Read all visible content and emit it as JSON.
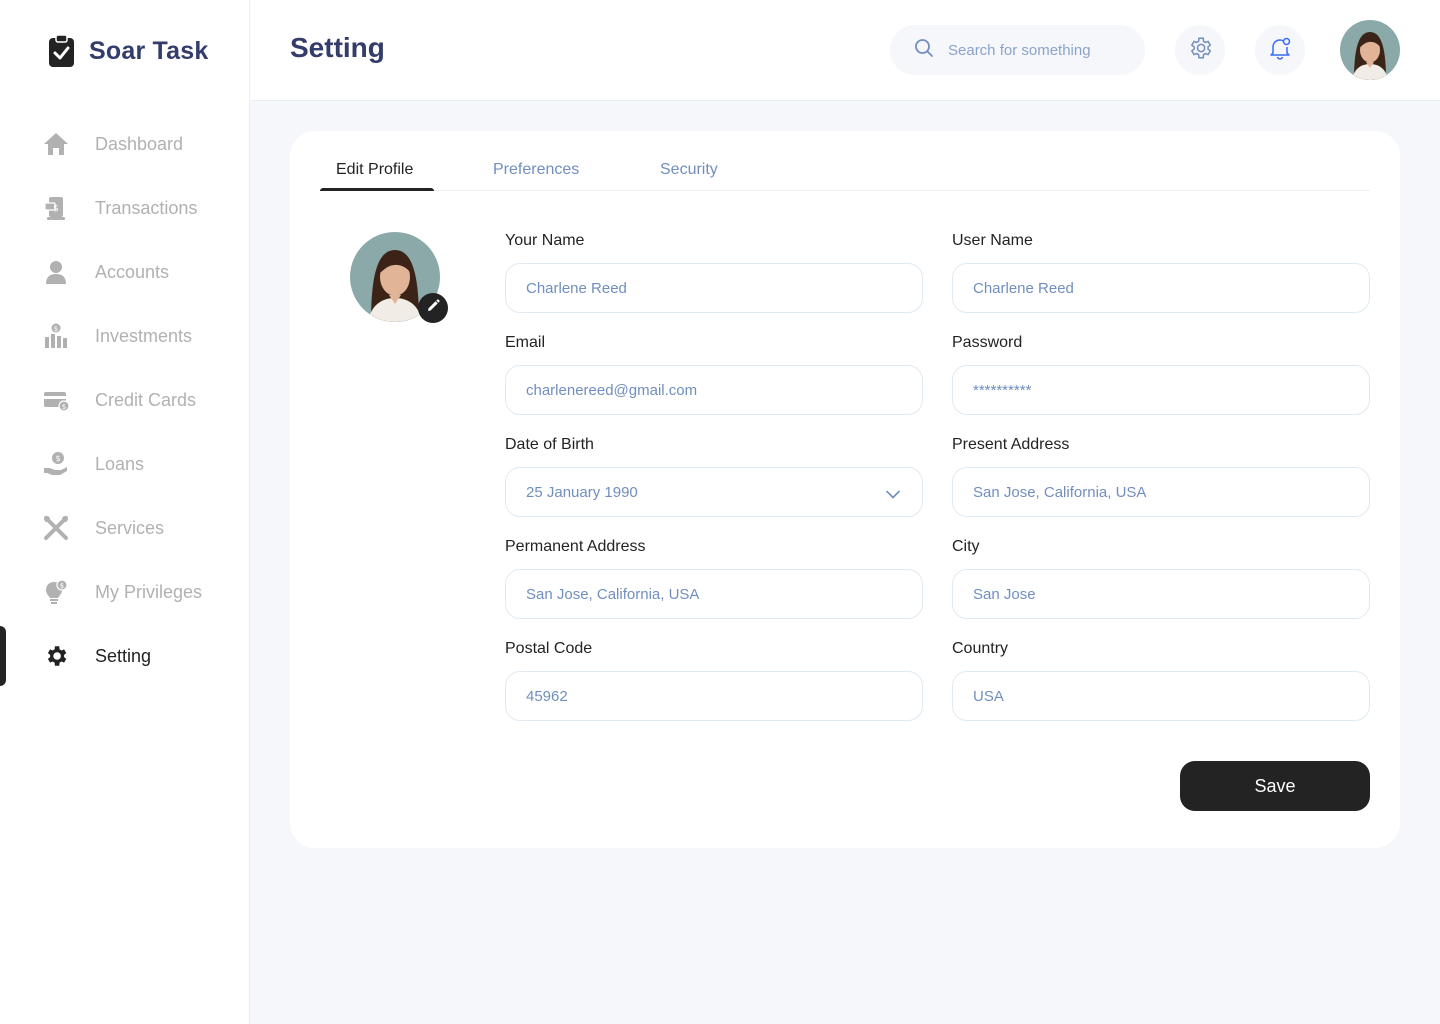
{
  "brand": {
    "name": "Soar Task",
    "icon": "clipboard-check-icon"
  },
  "sidebar": {
    "items": [
      {
        "label": "Dashboard",
        "icon": "home-icon",
        "active": false
      },
      {
        "label": "Transactions",
        "icon": "transfer-icon",
        "active": false
      },
      {
        "label": "Accounts",
        "icon": "user-icon",
        "active": false
      },
      {
        "label": "Investments",
        "icon": "investment-icon",
        "active": false
      },
      {
        "label": "Credit Cards",
        "icon": "credit-card-icon",
        "active": false
      },
      {
        "label": "Loans",
        "icon": "loan-icon",
        "active": false
      },
      {
        "label": "Services",
        "icon": "services-icon",
        "active": false
      },
      {
        "label": "My Privileges",
        "icon": "privileges-icon",
        "active": false
      },
      {
        "label": "Setting",
        "icon": "gear-icon",
        "active": true
      }
    ]
  },
  "header": {
    "title": "Setting",
    "search_placeholder": "Search for something"
  },
  "tabs": [
    {
      "label": "Edit Profile",
      "active": true
    },
    {
      "label": "Preferences",
      "active": false
    },
    {
      "label": "Security",
      "active": false
    }
  ],
  "form": {
    "your_name": {
      "label": "Your Name",
      "value": "Charlene Reed"
    },
    "user_name": {
      "label": "User Name",
      "value": "Charlene Reed"
    },
    "email": {
      "label": "Email",
      "value": "charlenereed@gmail.com"
    },
    "password": {
      "label": "Password",
      "value": "**********"
    },
    "dob": {
      "label": "Date of Birth",
      "value": "25 January 1990"
    },
    "present_address": {
      "label": "Present Address",
      "value": "San Jose, California, USA"
    },
    "permanent_address": {
      "label": "Permanent Address",
      "value": "San Jose, California, USA"
    },
    "city": {
      "label": "City",
      "value": "San Jose"
    },
    "postal_code": {
      "label": "Postal Code",
      "value": "45962"
    },
    "country": {
      "label": "Country",
      "value": "USA"
    }
  },
  "save_label": "Save",
  "colors": {
    "primary_text": "#343C6A",
    "muted": "#B1B1B1",
    "accent_blue": "#718EBF",
    "dark": "#232323",
    "background": "#F5F7FA"
  }
}
